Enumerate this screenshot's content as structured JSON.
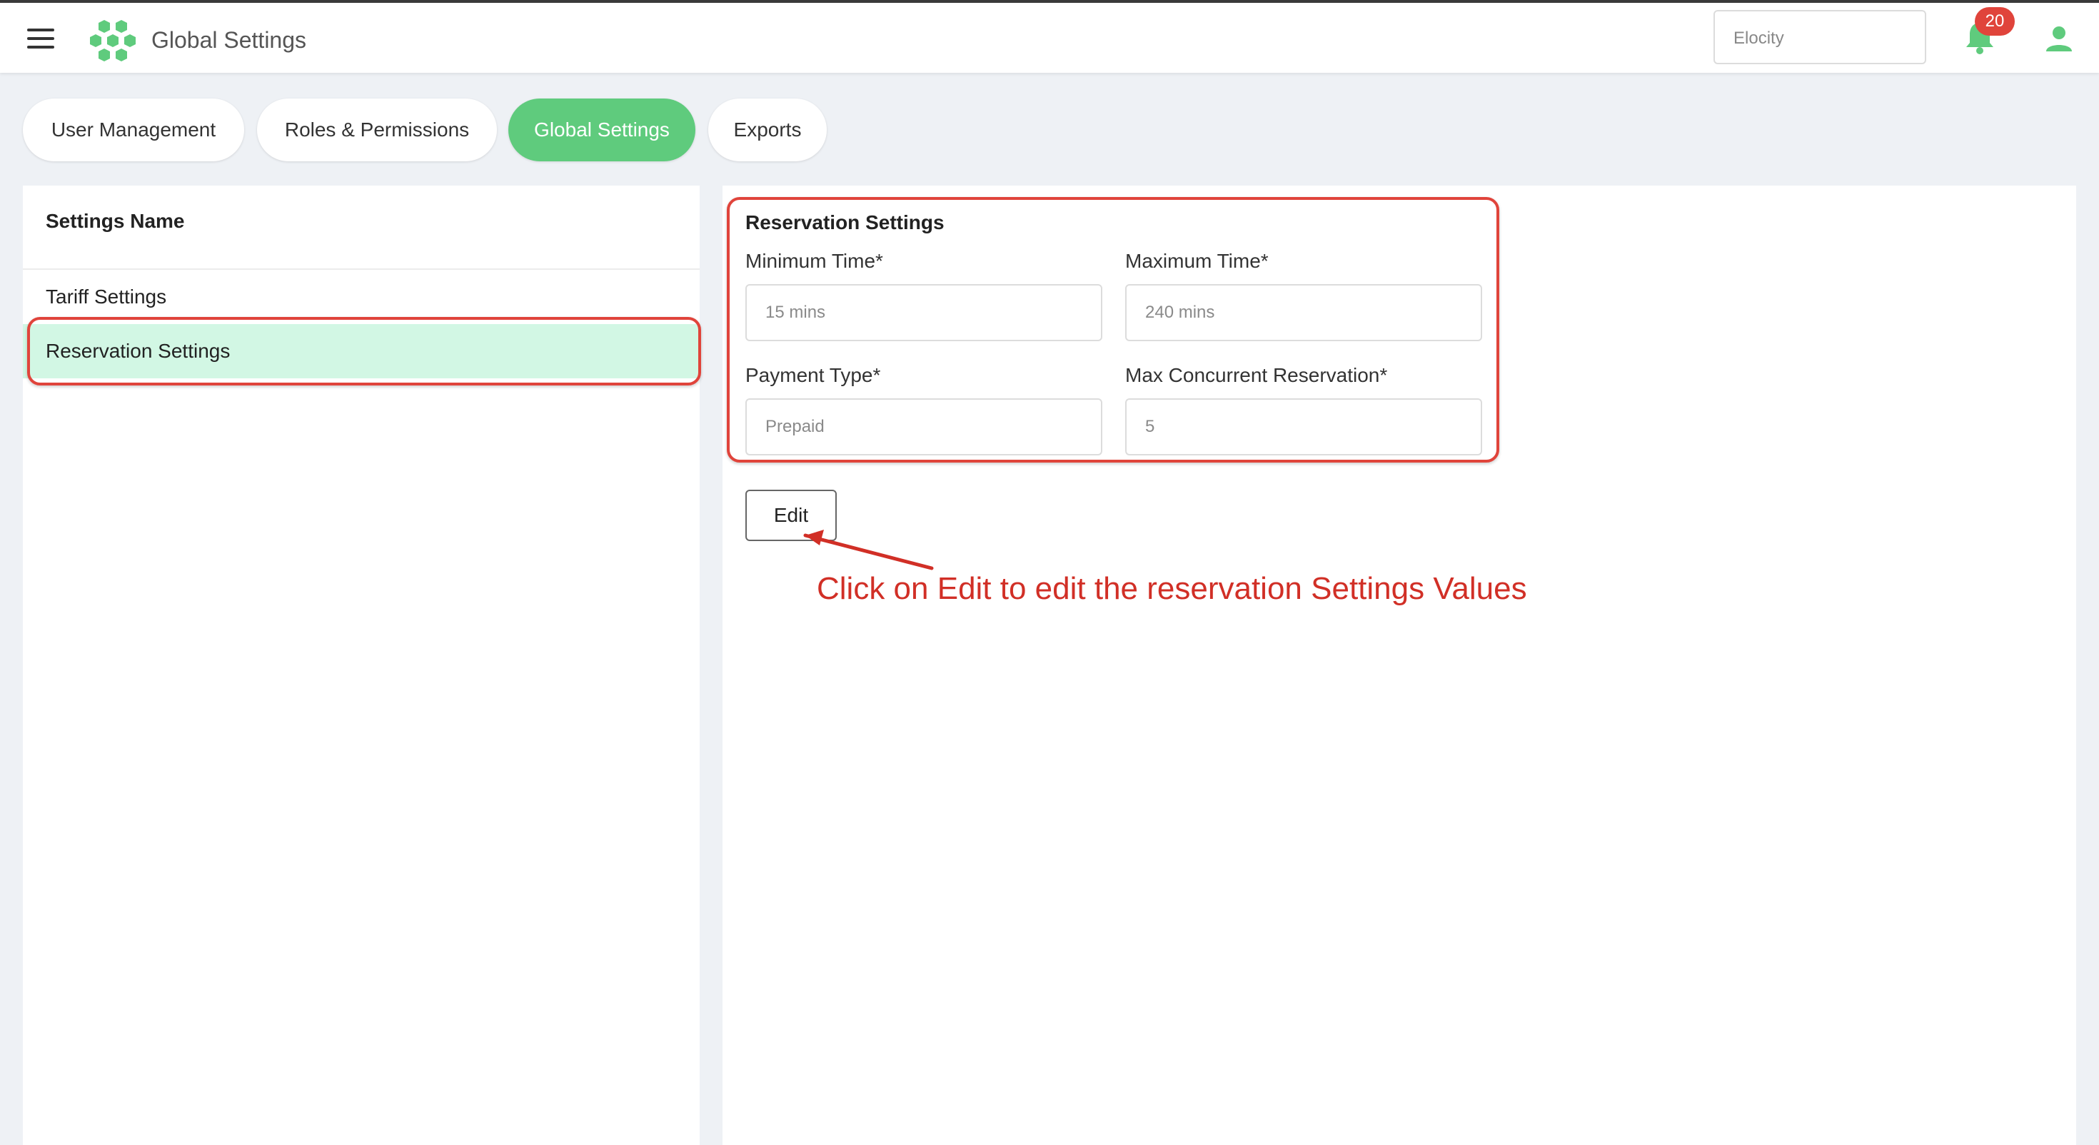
{
  "header": {
    "app_title": "Global Settings",
    "org_select_value": "Elocity",
    "notification_count": "20",
    "icons": [
      "menu-icon",
      "logo-icon",
      "bell-icon",
      "user-icon"
    ],
    "brand_color": "#5fcb7d",
    "badge_color": "#e0443b"
  },
  "tabs": [
    {
      "label": "User Management",
      "active": false
    },
    {
      "label": "Roles & Permissions",
      "active": false
    },
    {
      "label": "Global Settings",
      "active": true
    },
    {
      "label": "Exports",
      "active": false
    }
  ],
  "settings_list": {
    "header": "Settings Name",
    "items": [
      {
        "label": "Tariff Settings",
        "selected": false
      },
      {
        "label": "Reservation Settings",
        "selected": true
      }
    ]
  },
  "reservation_settings": {
    "title": "Reservation Settings",
    "fields": [
      {
        "label": "Minimum Time*",
        "placeholder": "15 mins"
      },
      {
        "label": "Maximum Time*",
        "placeholder": "240 mins"
      },
      {
        "label": "Payment Type*",
        "placeholder": "Prepaid"
      },
      {
        "label": "Max Concurrent Reservation*",
        "placeholder": "5"
      }
    ],
    "edit_label": "Edit"
  },
  "annotation": {
    "text": "Click on Edit to edit the reservation Settings Values",
    "color": "#d12f26"
  }
}
